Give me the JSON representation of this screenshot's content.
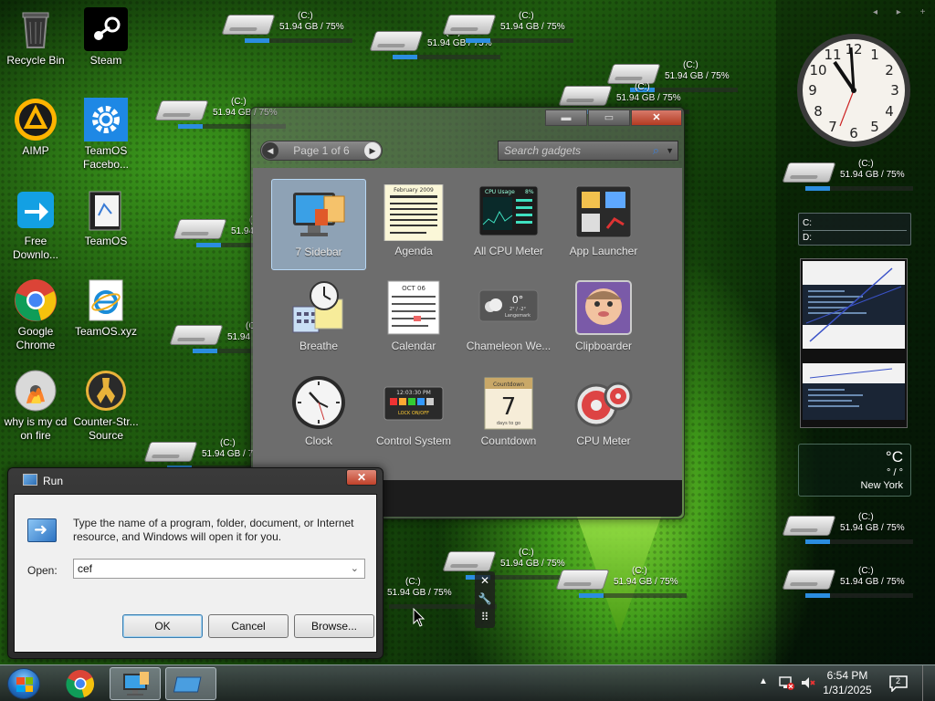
{
  "desktop": {
    "icons": [
      {
        "label": "Recycle Bin",
        "icon": "recycle-bin-icon"
      },
      {
        "label": "Steam",
        "icon": "steam-icon"
      },
      {
        "label": "AIMP",
        "icon": "aimp-icon"
      },
      {
        "label": "TeamOS Facebo...",
        "icon": "gear-icon"
      },
      {
        "label": "Free Downlo...",
        "icon": "free-download-icon"
      },
      {
        "label": "TeamOS",
        "icon": "teamos-folder-icon"
      },
      {
        "label": "Google Chrome",
        "icon": "chrome-icon"
      },
      {
        "label": "TeamOS.xyz",
        "icon": "internet-explorer-icon"
      },
      {
        "label": "why is my cd on fire",
        "icon": "burning-cd-icon"
      },
      {
        "label": "Counter-Str... Source",
        "icon": "counter-strike-icon"
      }
    ],
    "drive_gadget": {
      "letter": "(C:)",
      "usage": "51.94 GB / 75%",
      "fill_percent": 75
    }
  },
  "gadget_gallery": {
    "pager": "Page 1 of 6",
    "search_placeholder": "Search gadgets",
    "title_buttons": {
      "minimize": "▬",
      "maximize": "▭",
      "close": "✕"
    },
    "gadgets": [
      {
        "name": "7 Sidebar",
        "selected": true
      },
      {
        "name": "Agenda"
      },
      {
        "name": "All CPU Meter"
      },
      {
        "name": "App Launcher"
      },
      {
        "name": "Breathe"
      },
      {
        "name": "Calendar"
      },
      {
        "name": "Chameleon We..."
      },
      {
        "name": "Clipboarder"
      },
      {
        "name": "Clock"
      },
      {
        "name": "Control System"
      },
      {
        "name": "Countdown"
      },
      {
        "name": "CPU Meter"
      }
    ],
    "thumb_text": {
      "agenda_month": "February 2009",
      "calendar_month": "OCT 06",
      "chameleon_temp": "0°",
      "chameleon_range": "2° / -2°",
      "chameleon_city": "Langemark",
      "control_time": "12:03:30 PM",
      "control_lock": "LOCK ON/OFF",
      "countdown_label": "Countdown",
      "countdown_number": "7",
      "countdown_days": "days to go",
      "cpu_usage_label": "CPU Usage",
      "cpu_usage_value": "8%"
    }
  },
  "run_dialog": {
    "title": "Run",
    "description": "Type the name of a program, folder, document, or Internet resource, and Windows will open it for you.",
    "open_label": "Open:",
    "open_value": "cef",
    "ok_label": "OK",
    "cancel_label": "Cancel",
    "browse_label": "Browse...",
    "close_label": "✕"
  },
  "sidebar": {
    "nav": "◂ ▸ +",
    "drive_list": [
      "C:",
      "D:"
    ],
    "weather": {
      "temp": "°C",
      "range": "° / °",
      "city": "New York"
    }
  },
  "taskbar": {
    "time": "6:54 PM",
    "date": "1/31/2025",
    "notification_count": "2"
  }
}
